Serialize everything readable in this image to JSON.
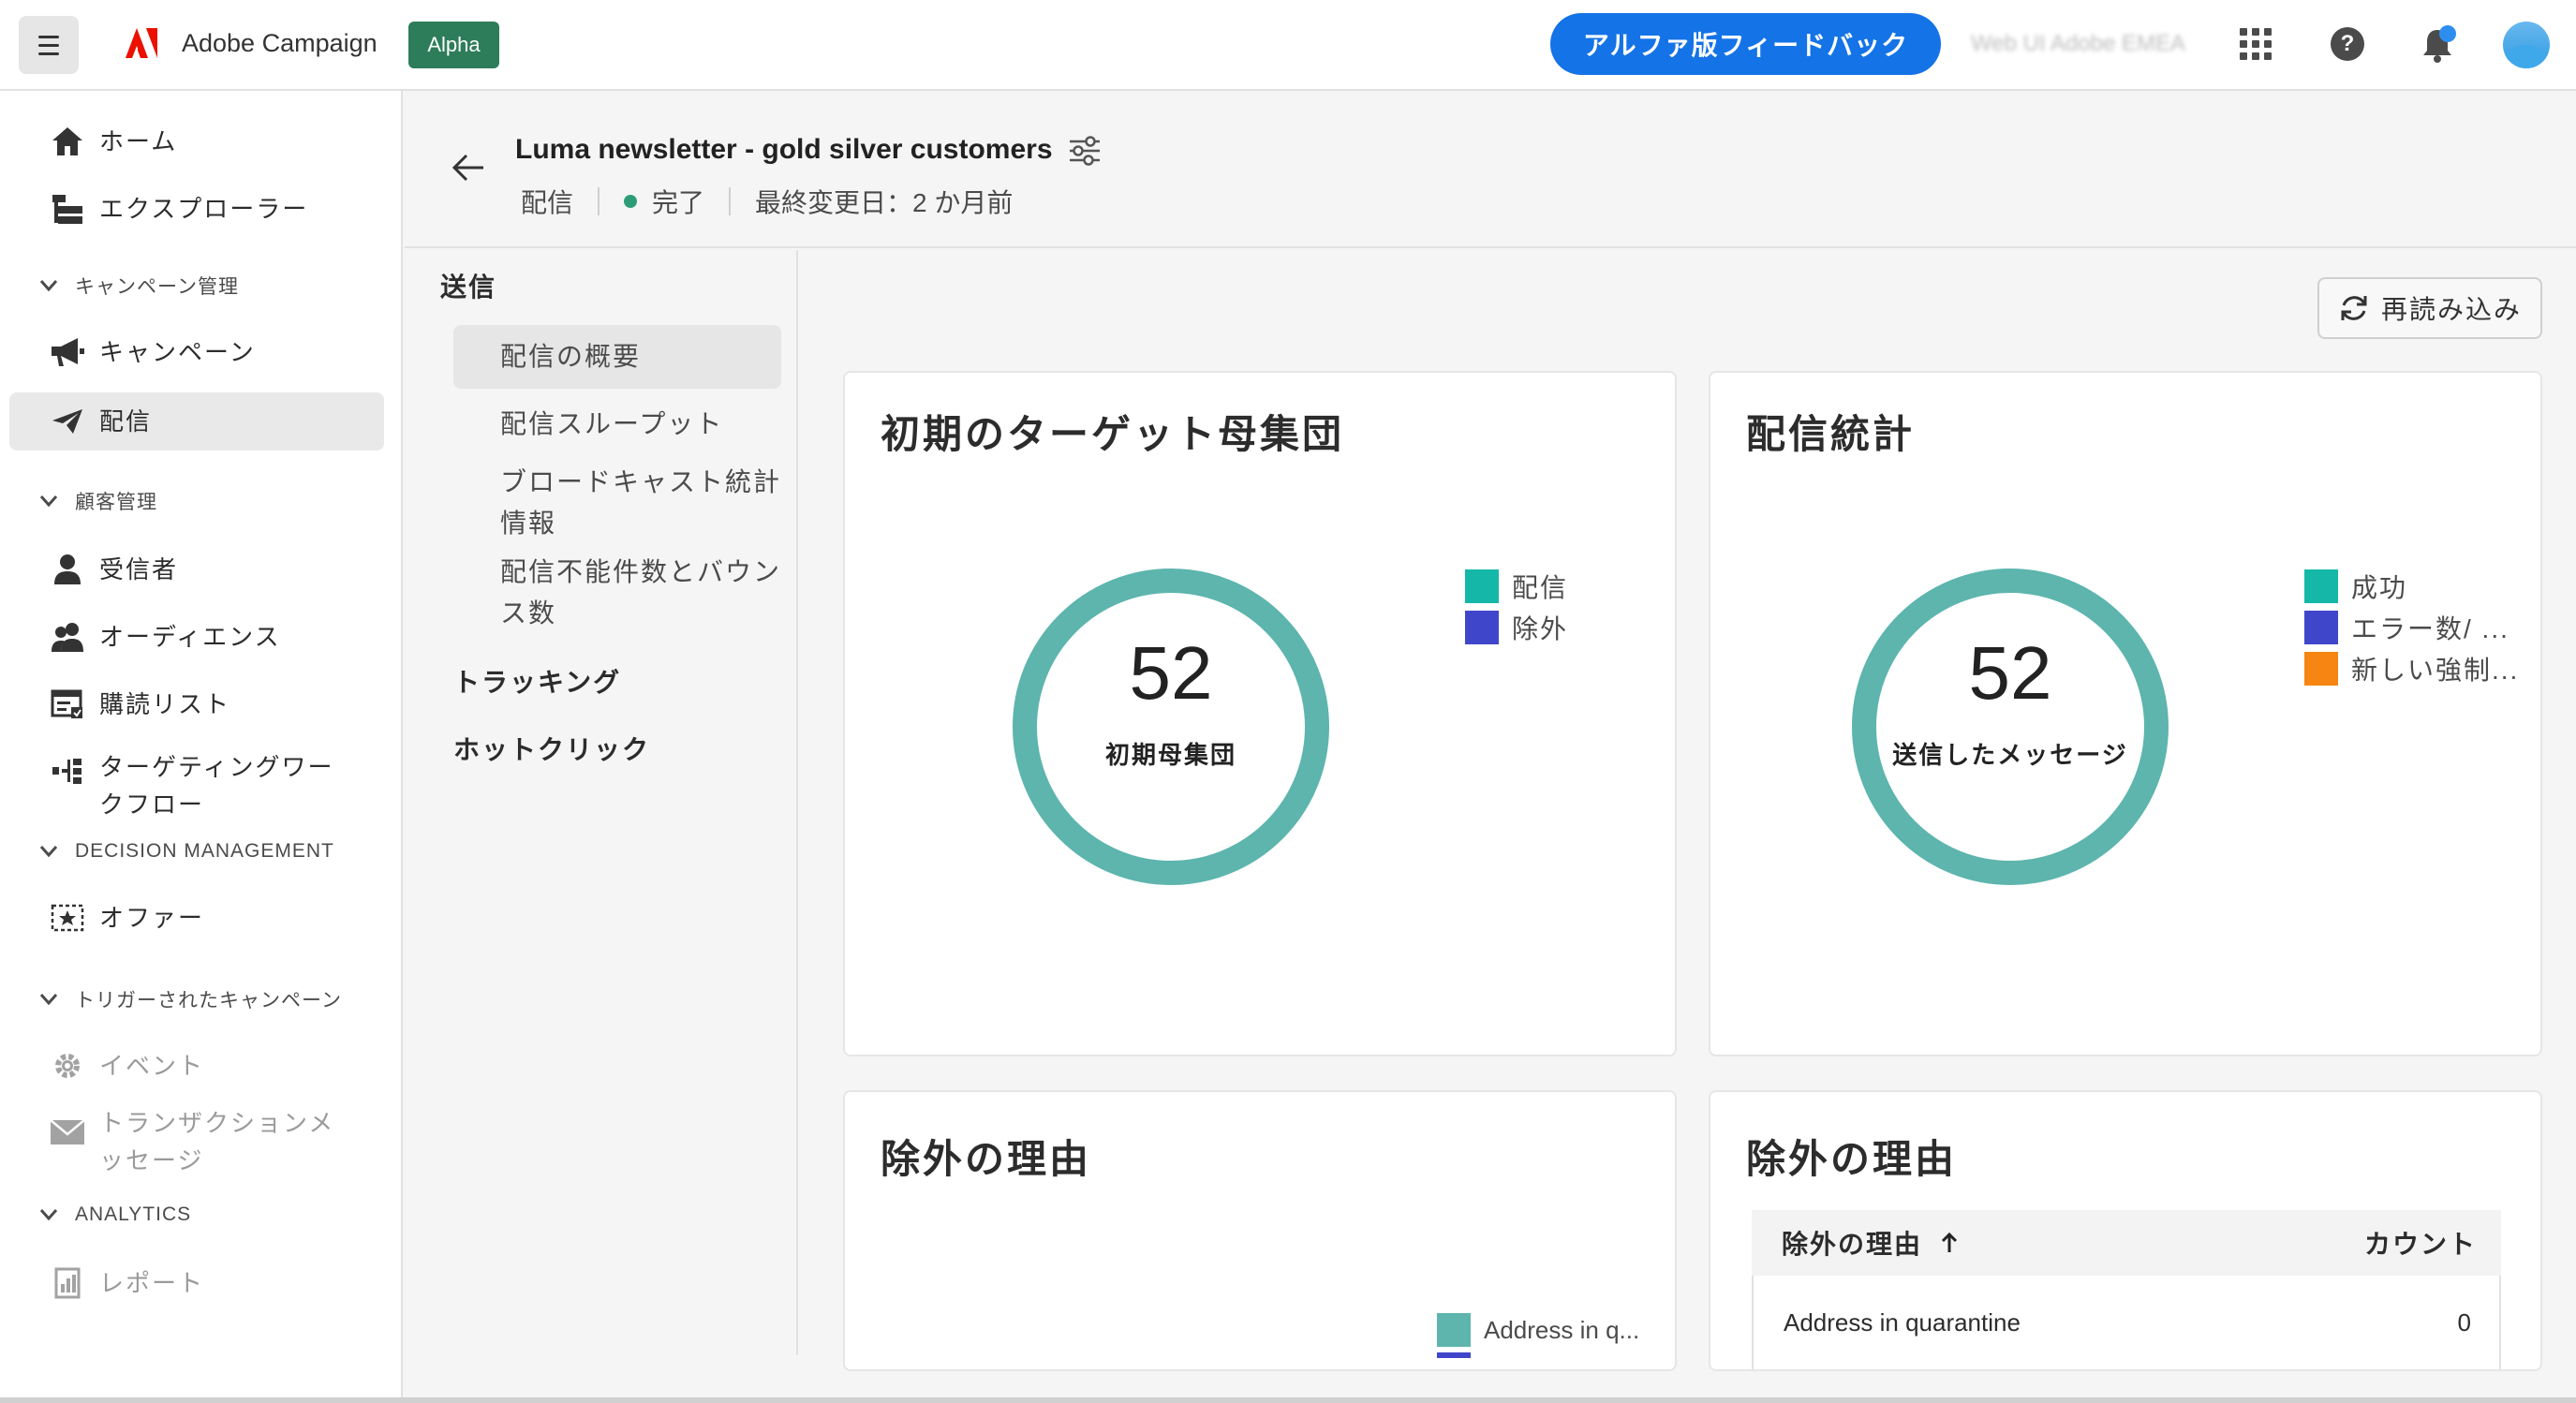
{
  "topbar": {
    "app_name": "Adobe Campaign",
    "badge": "Alpha",
    "feedback_label": "アルファ版フィードバック",
    "org_name": "Web UI Adobe EMEA"
  },
  "sidebar": {
    "items": [
      {
        "label": "ホーム",
        "icon": "home-icon"
      },
      {
        "label": "エクスプローラー",
        "icon": "explorer-icon"
      },
      {
        "label": "キャンペーン",
        "icon": "megaphone-icon"
      },
      {
        "label": "配信",
        "icon": "paper-plane-icon"
      },
      {
        "label": "受信者",
        "icon": "person-icon"
      },
      {
        "label": "オーディエンス",
        "icon": "people-icon"
      },
      {
        "label": "購読リスト",
        "icon": "subscription-list-icon"
      },
      {
        "label": "ターゲティングワー",
        "label2": "クフロー",
        "icon": "workflow-icon"
      },
      {
        "label": "オファー",
        "icon": "offer-icon"
      },
      {
        "label": "イベント",
        "icon": "gear-icon"
      },
      {
        "label": "トランザクションメ",
        "label2": "ッセージ",
        "icon": "envelope-icon"
      },
      {
        "label": "レポート",
        "icon": "report-icon"
      }
    ],
    "sections": {
      "campaign": "キャンペーン管理",
      "customer": "顧客管理",
      "decision": "DECISION MANAGEMENT",
      "triggered": "トリガーされたキャンペーン",
      "analytics": "ANALYTICS"
    }
  },
  "header": {
    "title": "Luma newsletter - gold silver customers",
    "type": "配信",
    "status": "完了",
    "last_modified": "最終変更日：2 か月前"
  },
  "subnav": {
    "group_send": "送信",
    "items": [
      "配信の概要",
      "配信スループット",
      "ブロードキャスト統計",
      "情報",
      "配信不能件数とバウン",
      "ス数"
    ],
    "group_tracking": "トラッキング",
    "group_hotclick": "ホットクリック"
  },
  "toolbar": {
    "reload_label": "再読み込み"
  },
  "cards": {
    "initial_target": {
      "title": "初期のターゲット母集団",
      "value": "52",
      "center_label": "初期母集団",
      "legend": [
        {
          "label": "配信",
          "color": "#15b8a8"
        },
        {
          "label": "除外",
          "color": "#4046ca"
        }
      ],
      "ring_color": "#5db5ad"
    },
    "delivery_stats": {
      "title": "配信統計",
      "value": "52",
      "center_label": "送信したメッセージ",
      "legend": [
        {
          "label": "成功",
          "color": "#15b8a8"
        },
        {
          "label": "エラー数/ ...",
          "color": "#4046ca"
        },
        {
          "label": "新しい強制...",
          "color": "#f68511"
        }
      ],
      "ring_color": "#5db5ad"
    },
    "exclusion_chart": {
      "title": "除外の理由",
      "legend": [
        {
          "label": "Address in q...",
          "color": "#5db5ad"
        }
      ]
    },
    "exclusion_table": {
      "title": "除外の理由",
      "col_reason": "除外の理由",
      "col_count": "カウント",
      "rows": [
        {
          "reason": "Address in quarantine",
          "count": "0"
        }
      ]
    }
  }
}
